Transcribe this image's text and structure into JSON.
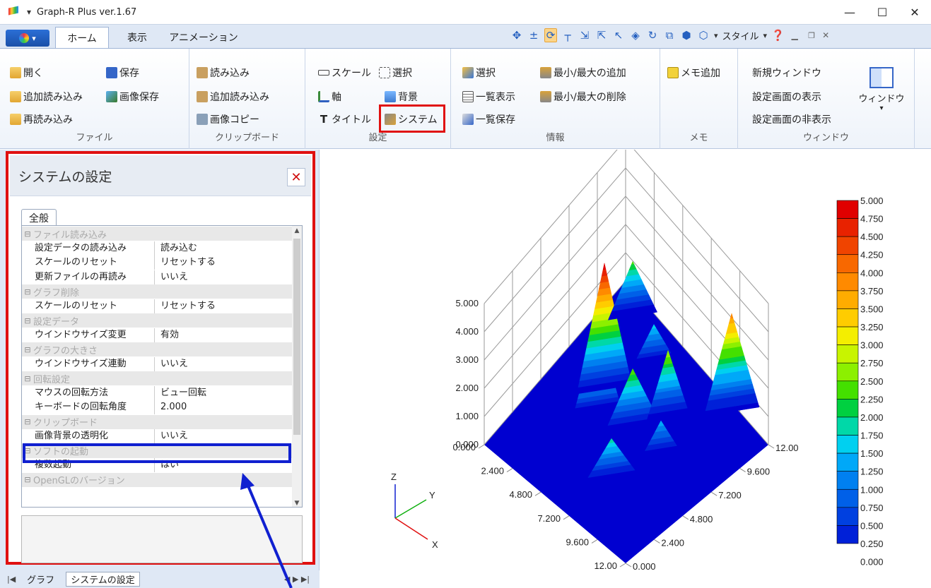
{
  "window": {
    "title": "Graph-R Plus ver.1.67",
    "controls": [
      "—",
      "☐",
      "✕"
    ]
  },
  "tabs": {
    "home": "ホーム",
    "view": "表示",
    "animation": "アニメーション",
    "style": "スタイル"
  },
  "ribbon": {
    "file": {
      "open": "開く",
      "save": "保存",
      "add_load": "追加読み込み",
      "image_save": "画像保存",
      "reload": "再読み込み",
      "title": "ファイル"
    },
    "clipboard": {
      "load": "読み込み",
      "add_load": "追加読み込み",
      "image_copy": "画像コピー",
      "title": "クリップボード"
    },
    "settings": {
      "scale": "スケール",
      "select": "選択",
      "axis": "軸",
      "background": "背景",
      "title_item": "タイトル",
      "system": "システム",
      "title": "設定"
    },
    "info": {
      "select": "選択",
      "add_minmax": "最小/最大の追加",
      "list_view": "一覧表示",
      "remove_minmax": "最小/最大の削除",
      "list_save": "一覧保存",
      "title": "情報"
    },
    "memo": {
      "add": "メモ追加",
      "title": "メモ"
    },
    "window": {
      "new_window": "新規ウィンドウ",
      "show_settings": "設定画面の表示",
      "hide_settings": "設定画面の非表示",
      "window_btn": "ウィンドウ",
      "title": "ウィンドウ"
    }
  },
  "panel": {
    "title": "システムの設定",
    "tab": "全般",
    "rows": [
      {
        "type": "cat",
        "label": "ファイル読み込み"
      },
      {
        "type": "prop",
        "label": "設定データの読み込み",
        "value": "読み込む"
      },
      {
        "type": "prop",
        "label": "スケールのリセット",
        "value": "リセットする"
      },
      {
        "type": "prop",
        "label": "更新ファイルの再読み",
        "value": "いいえ"
      },
      {
        "type": "cat",
        "label": "グラフ削除"
      },
      {
        "type": "prop",
        "label": "スケールのリセット",
        "value": "リセットする"
      },
      {
        "type": "cat",
        "label": "設定データ"
      },
      {
        "type": "prop",
        "label": "ウインドウサイズ変更",
        "value": "有効"
      },
      {
        "type": "cat",
        "label": "グラフの大きさ"
      },
      {
        "type": "prop",
        "label": "ウインドウサイズ連動",
        "value": "いいえ"
      },
      {
        "type": "cat",
        "label": "回転設定"
      },
      {
        "type": "prop",
        "label": "マウスの回転方法",
        "value": "ビュー回転"
      },
      {
        "type": "prop",
        "label": "キーボードの回転角度",
        "value": "2.000"
      },
      {
        "type": "cat",
        "label": "クリップボード"
      },
      {
        "type": "prop",
        "label": "画像背景の透明化",
        "value": "いいえ"
      },
      {
        "type": "cat",
        "label": "ソフトの起動"
      },
      {
        "type": "prop",
        "label": "複数起動",
        "value": "はい"
      },
      {
        "type": "cat",
        "label": "OpenGLのバージョン"
      }
    ]
  },
  "bottom_tabs": {
    "graph": "グラフ",
    "system": "システムの設定"
  },
  "chart_data": {
    "type": "surface3d",
    "z_ticks": [
      "0.000",
      "1.000",
      "2.000",
      "3.000",
      "4.000",
      "5.000"
    ],
    "x_ticks": [
      "0.000",
      "2.400",
      "4.800",
      "7.200",
      "9.600",
      "12.00"
    ],
    "y_ticks": [
      "0.000",
      "2.400",
      "4.800",
      "7.200",
      "9.600",
      "12.00"
    ],
    "axes_triad": {
      "z": "Z",
      "y": "Y",
      "x": "X"
    },
    "colorbar": [
      "5.000",
      "4.750",
      "4.500",
      "4.250",
      "4.000",
      "3.750",
      "3.500",
      "3.250",
      "3.000",
      "2.750",
      "2.500",
      "2.250",
      "2.000",
      "1.750",
      "1.500",
      "1.250",
      "1.000",
      "0.750",
      "0.500",
      "0.250",
      "0.000"
    ],
    "colors": [
      "#e00000",
      "#e82200",
      "#f04400",
      "#f86800",
      "#ff8a00",
      "#ffac00",
      "#ffcc00",
      "#f4ee00",
      "#c8f400",
      "#8cf000",
      "#44e000",
      "#00d040",
      "#00d8a8",
      "#00d0f0",
      "#00a8f8",
      "#0080f0",
      "#0060e8",
      "#0040e0",
      "#0020d8",
      "#0000d0"
    ]
  }
}
